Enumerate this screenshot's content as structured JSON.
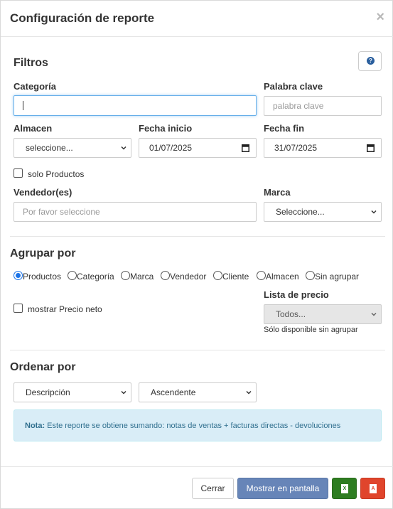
{
  "dialog": {
    "title": "Configuración de reporte",
    "close_glyph": "×"
  },
  "filters": {
    "heading": "Filtros",
    "help_glyph": "?",
    "category_label": "Categoría",
    "category_value": "",
    "keyword_label": "Palabra clave",
    "keyword_placeholder": "palabra clave",
    "warehouse_label": "Almacen",
    "warehouse_selected": "seleccione...",
    "start_date_label": "Fecha inicio",
    "start_date_value": "01/07/2025",
    "end_date_label": "Fecha fin",
    "end_date_value": "31/07/2025",
    "only_products_label": "solo Productos",
    "only_products_checked": false,
    "sellers_label": "Vendedor(es)",
    "sellers_placeholder": "Por favor seleccione",
    "brand_label": "Marca",
    "brand_selected": "Seleccione..."
  },
  "group_by": {
    "heading": "Agrupar por",
    "options": [
      "Productos",
      "Categoría",
      "Marca",
      "Vendedor",
      "Cliente",
      "Almacen",
      "Sin agrupar"
    ],
    "selected": "Productos",
    "net_price_label": "mostrar Precio neto",
    "net_price_checked": false,
    "price_list_label": "Lista de precio",
    "price_list_selected": "Todos...",
    "price_list_hint": "Sólo disponible sin agrupar"
  },
  "order_by": {
    "heading": "Ordenar por",
    "field_selected": "Descripción",
    "direction_selected": "Ascendente"
  },
  "note": {
    "label": "Nota:",
    "text": "Este reporte se obtiene sumando: notas de ventas + facturas directas - devoluciones"
  },
  "footer": {
    "close_label": "Cerrar",
    "show_label": "Mostrar en pantalla",
    "excel_icon": "excel-file-icon",
    "pdf_icon": "pdf-file-icon"
  },
  "colors": {
    "primary": "#6785b8",
    "excel": "#2e7d21",
    "pdf": "#e0452c",
    "info_bg": "#d9edf7",
    "radio_accent": "#1a73e8"
  }
}
